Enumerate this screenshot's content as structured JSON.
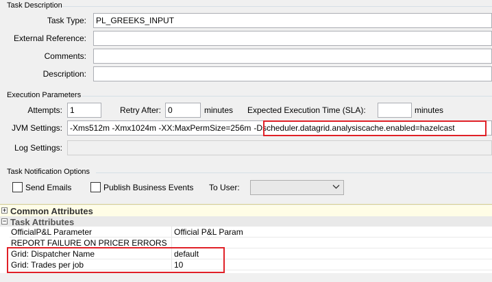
{
  "task_description": {
    "legend": "Task Description",
    "task_type_label": "Task Type:",
    "task_type_value": "PL_GREEKS_INPUT",
    "external_reference_label": "External Reference:",
    "external_reference_value": "",
    "comments_label": "Comments:",
    "comments_value": "",
    "description_label": "Description:",
    "description_value": ""
  },
  "execution_parameters": {
    "legend": "Execution Parameters",
    "attempts_label": "Attempts:",
    "attempts_value": "1",
    "retry_after_label": "Retry After:",
    "retry_after_value": "0",
    "retry_unit": "minutes",
    "sla_label": "Expected Execution Time (SLA):",
    "sla_value": "",
    "sla_unit": "minutes",
    "jvm_label": "JVM Settings:",
    "jvm_value_part1": "-Xms512m -Xmx1024m -XX:MaxPermSize=256m",
    "jvm_value_part2": "-Dscheduler.datagrid.analysiscache.enabled=hazelcast",
    "log_settings_label": "Log Settings:",
    "log_settings_value": ""
  },
  "notification": {
    "legend": "Task Notification Options",
    "send_emails_label": "Send Emails",
    "send_emails_checked": false,
    "publish_events_label": "Publish Business Events",
    "publish_events_checked": false,
    "to_user_label": "To User:",
    "to_user_value": ""
  },
  "sections": {
    "common_attributes": {
      "label": "Common Attributes",
      "expander": "+"
    },
    "task_attributes": {
      "label": "Task Attributes",
      "expander": "−"
    }
  },
  "task_attributes_rows": [
    {
      "key": "OfficialP&L Parameter",
      "value": "Official P&L Param"
    },
    {
      "key": "REPORT FAILURE ON PRICER ERRORS",
      "value": ""
    },
    {
      "key": "Grid: Dispatcher Name",
      "value": "default"
    },
    {
      "key": "Grid: Trades per job",
      "value": "10"
    }
  ],
  "colors": {
    "highlight_box": "#e01f26",
    "section_band": "#fffde0",
    "section_band_line": "#d8d08a"
  }
}
